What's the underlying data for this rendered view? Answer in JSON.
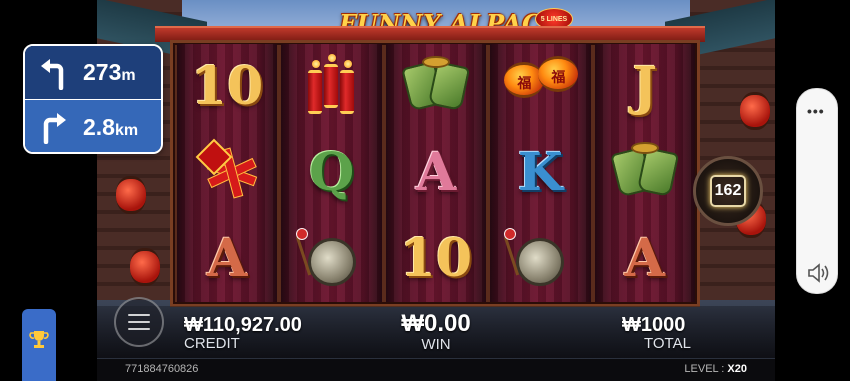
{
  "game": {
    "title": "FUNNY ALPACA",
    "lines_badge": "5 LINES"
  },
  "reels": [
    {
      "symbols": [
        "10",
        "firecrackers-bundle",
        "A"
      ]
    },
    {
      "symbols": [
        "firecrackers",
        "Q",
        "gong"
      ]
    },
    {
      "symbols": [
        "pouches",
        "A",
        "10"
      ]
    },
    {
      "symbols": [
        "lanterns",
        "K",
        "gong"
      ]
    },
    {
      "symbols": [
        "J",
        "pouches",
        "A"
      ]
    }
  ],
  "labels": {
    "r0c0": "10",
    "r2c0": "A",
    "r1c1": "Q",
    "r1c2": "A",
    "r2c2": "10",
    "r1c3": "K",
    "r0c4": "J",
    "r2c4": "A",
    "lantern_char_1": "福",
    "lantern_char_2": "福"
  },
  "counter": {
    "value": "162"
  },
  "stats": {
    "credit_value": "₩110,927.00",
    "credit_label": "CREDIT",
    "win_value": "₩0.00",
    "win_label": "WIN",
    "total_value": "₩1000",
    "total_label": "TOTAL"
  },
  "footer": {
    "game_id": "771884760826",
    "level_label": "LEVEL : ",
    "level_value": "X20"
  },
  "navigation": {
    "turn1_distance": "273",
    "turn1_unit": "m",
    "turn2_distance": "2.8",
    "turn2_unit": "km",
    "turn1_icon": "turn-left-arrow-icon",
    "turn2_icon": "turn-right-arrow-icon"
  },
  "side_panel": {
    "menu_icon": "more-dots-icon",
    "sound_icon": "sound-icon"
  },
  "colors": {
    "accent_gold": "#f4c35a",
    "nav_top": "#1e3f7a",
    "nav_bottom": "#3568b8",
    "trophy_button": "#3a6cc8"
  }
}
